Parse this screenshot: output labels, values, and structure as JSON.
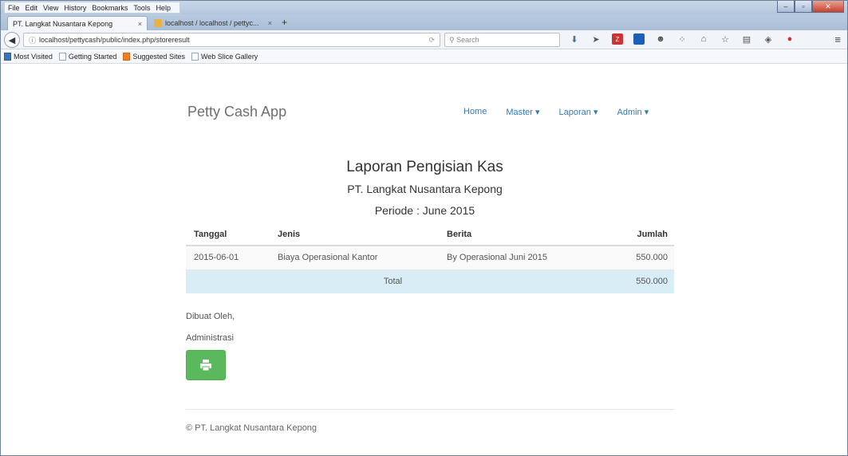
{
  "browser": {
    "menu": [
      "File",
      "Edit",
      "View",
      "History",
      "Bookmarks",
      "Tools",
      "Help"
    ],
    "tabs": [
      {
        "title": "PT. Langkat Nusantara Kepong",
        "close": "×"
      },
      {
        "title": "localhost / localhost / pettyc...",
        "close": "×"
      }
    ],
    "new_tab": "+",
    "url": "localhost/pettycash/public/index.php/storeresult",
    "search_placeholder": "Search",
    "bookmarks": [
      "Most Visited",
      "Getting Started",
      "Suggested Sites",
      "Web Slice Gallery"
    ],
    "colors": {
      "chrome": "#b9cbe1",
      "close_button": "#c8412b"
    }
  },
  "app": {
    "brand": "Petty Cash App",
    "nav": [
      "Home",
      "Master ▾",
      "Laporan ▾",
      "Admin ▾"
    ],
    "link_color": "#337ab7"
  },
  "report": {
    "title": "Laporan Pengisian Kas",
    "company": "PT. Langkat Nusantara Kepong",
    "period": "Periode : June 2015",
    "columns": [
      "Tanggal",
      "Jenis",
      "Berita",
      "Jumlah"
    ],
    "rows": [
      {
        "tanggal": "2015-06-01",
        "jenis": "Biaya Operasional Kantor",
        "berita": "By Operasional Juni 2015",
        "jumlah": "550.000"
      }
    ],
    "total_label": "Total",
    "total_value": "550.000",
    "signed_by": "Dibuat Oleh,",
    "signer": "Administrasi",
    "print_button_color": "#5cb85c"
  },
  "footer": {
    "text": "© PT. Langkat Nusantara Kepong"
  }
}
